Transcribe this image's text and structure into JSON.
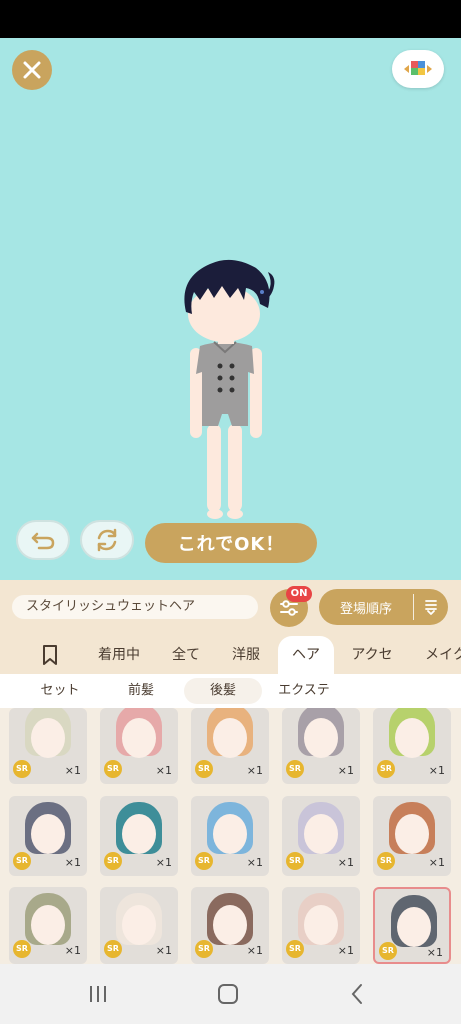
{
  "app": {
    "ok_label": "これでOK！",
    "item_name": "スタイリッシュウェットヘア",
    "filter_badge": "ON",
    "sort_label": "登場順序"
  },
  "tabs": [
    {
      "label": "",
      "icon": "bookmark-icon"
    },
    {
      "label": "着用中"
    },
    {
      "label": "全て"
    },
    {
      "label": "洋服"
    },
    {
      "label": "ヘア",
      "active": true
    },
    {
      "label": "アクセ"
    },
    {
      "label": "メイク"
    }
  ],
  "subtabs": [
    {
      "label": "セット"
    },
    {
      "label": "前髪"
    },
    {
      "label": "後髪",
      "active": true
    },
    {
      "label": "エクステ"
    }
  ],
  "items": [
    {
      "rarity": "SR",
      "count": "×1",
      "hair_color": "#d9d8c2"
    },
    {
      "rarity": "SR",
      "count": "×1",
      "hair_color": "#e6a9a9"
    },
    {
      "rarity": "SR",
      "count": "×1",
      "hair_color": "#e8b27e"
    },
    {
      "rarity": "SR",
      "count": "×1",
      "hair_color": "#a8a0a8"
    },
    {
      "rarity": "SR",
      "count": "×1",
      "hair_color": "#b7d16c"
    },
    {
      "rarity": "SR",
      "count": "×1",
      "hair_color": "#6b6f82"
    },
    {
      "rarity": "SR",
      "count": "×1",
      "hair_color": "#3e8e99"
    },
    {
      "rarity": "SR",
      "count": "×1",
      "hair_color": "#7db5dc"
    },
    {
      "rarity": "SR",
      "count": "×1",
      "hair_color": "#c9c4d9"
    },
    {
      "rarity": "SR",
      "count": "×1",
      "hair_color": "#c77f5a"
    },
    {
      "rarity": "SR",
      "count": "×1",
      "hair_color": "#a8a98a"
    },
    {
      "rarity": "SR",
      "count": "×1",
      "hair_color": "#eee5dc"
    },
    {
      "rarity": "SR",
      "count": "×1",
      "hair_color": "#8a6a5e"
    },
    {
      "rarity": "SR",
      "count": "×1",
      "hair_color": "#e8cfc6"
    },
    {
      "rarity": "SR",
      "count": "×1",
      "hair_color": "#5f6670",
      "selected": true
    }
  ],
  "colors": {
    "stage": "#a6e6e4",
    "accent": "#c9a45e",
    "badge": "#e84545",
    "rarity": "#e7b62f"
  }
}
